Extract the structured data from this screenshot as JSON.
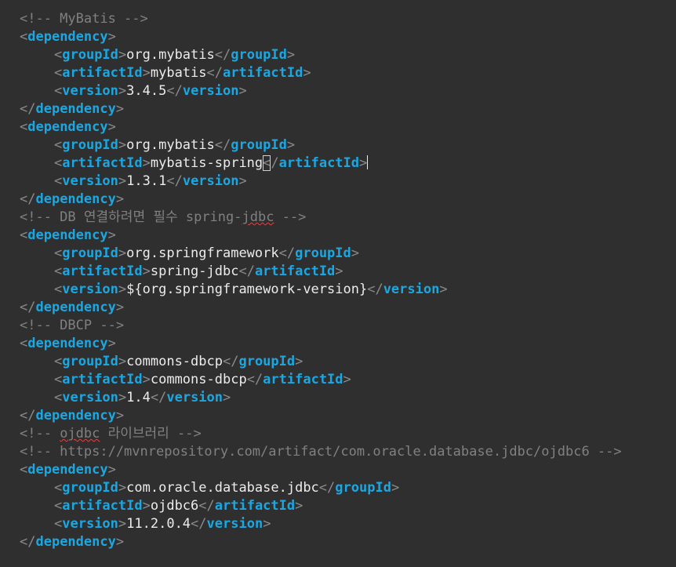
{
  "comments": {
    "mybatis": "<!-- MyBatis -->",
    "db_prefix": "<!-- DB ",
    "db_korean": "연결하려면 필수 ",
    "db_spring": "spring-",
    "db_jdbc": "jdbc",
    "db_suffix": " -->",
    "dbcp": "<!-- DBCP -->",
    "ojdbc_prefix": "<!-- ",
    "ojdbc_word": "ojdbc",
    "ojdbc_korean": " 라이브러리",
    "ojdbc_suffix": " -->",
    "mvn_url": "<!-- https://mvnrepository.com/artifact/com.oracle.database.jdbc/ojdbc6 -->"
  },
  "tags": {
    "dependency": "dependency",
    "groupId": "groupId",
    "artifactId": "artifactId",
    "version": "version"
  },
  "dependencies": [
    {
      "groupId": "org.mybatis",
      "artifactId": "mybatis",
      "version": "3.4.5"
    },
    {
      "groupId": "org.mybatis",
      "artifactId": "mybatis-spring",
      "version": "1.3.1"
    },
    {
      "groupId": "org.springframework",
      "artifactId": "spring-jdbc",
      "version": "${org.springframework-version}"
    },
    {
      "groupId": "commons-dbcp",
      "artifactId": "commons-dbcp",
      "version": "1.4"
    },
    {
      "groupId": "com.oracle.database.jdbc",
      "artifactId": "ojdbc6",
      "version": "11.2.0.4"
    }
  ],
  "editor": {
    "current_line": "artifactId mybatis-spring",
    "colors": {
      "background": "#2f2f2f",
      "current_line": "#393939",
      "tag": "#1aa7e2",
      "bracket": "#888a8c",
      "text": "#ececec",
      "comment": "#808080",
      "spell_error": "#e04444"
    }
  }
}
